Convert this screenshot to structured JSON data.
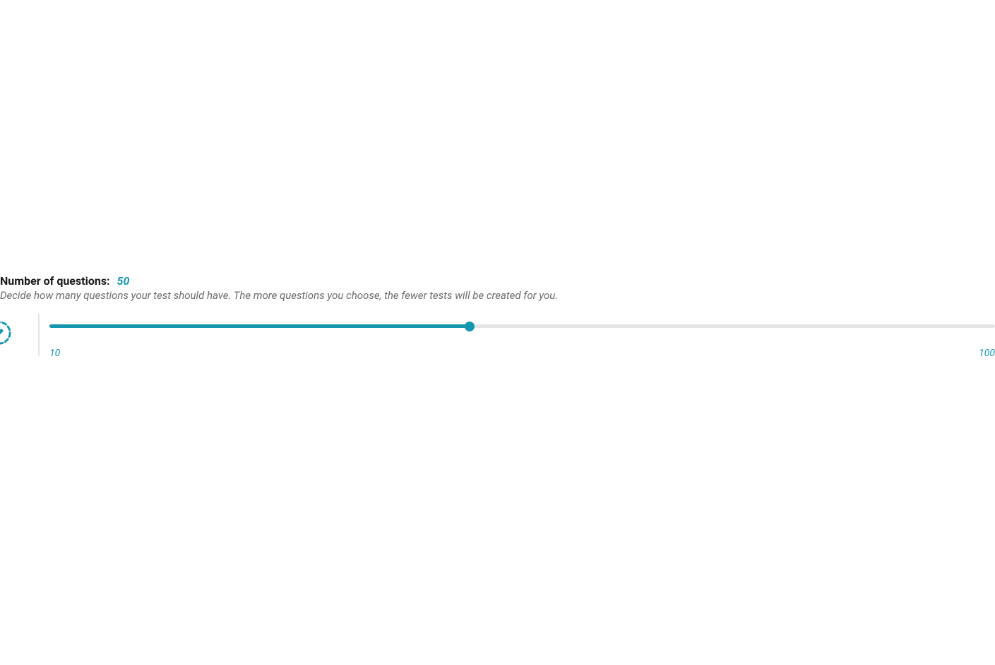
{
  "header": {
    "label": "Number of questions:",
    "value": "50"
  },
  "description": "Decide how many questions your test should have. The more questions you choose, the fewer tests will be created for you.",
  "slider": {
    "min": 10,
    "max": 100,
    "current": 50,
    "min_label": "10",
    "max_label": "100",
    "fill_percent": "44.4%"
  },
  "colors": {
    "accent": "#1396b0",
    "text_primary": "#1a1a1a",
    "text_secondary": "#6b6b6b",
    "track_bg": "#e5e5e5"
  }
}
